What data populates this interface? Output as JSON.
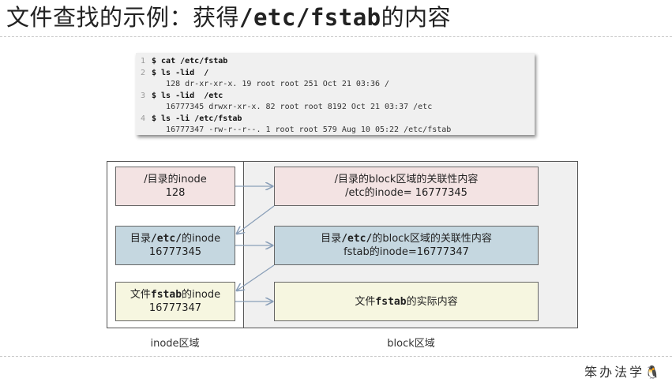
{
  "title": {
    "prefix": "文件查找的示例：获得",
    "path": "/etc/fstab",
    "suffix": "的内容"
  },
  "code_lines": [
    {
      "num": "1",
      "text": "$ cat /etc/fstab",
      "kind": "cmd"
    },
    {
      "num": "2",
      "text": "$ ls -lid  /",
      "kind": "cmd"
    },
    {
      "num": "",
      "text": "   128 dr-xr-xr-x. 19 root root 251 Oct 21 03:36 /",
      "kind": "out"
    },
    {
      "num": "3",
      "text": "$ ls -lid  /etc",
      "kind": "cmd"
    },
    {
      "num": "",
      "text": "   16777345 drwxr-xr-x. 82 root root 8192 Oct 21 03:37 /etc",
      "kind": "out"
    },
    {
      "num": "4",
      "text": "$ ls -li /etc/fstab",
      "kind": "cmd"
    },
    {
      "num": "",
      "text": "   16777347 -rw-r--r--. 1 root root 579 Aug 10 05:22 /etc/fstab",
      "kind": "out"
    }
  ],
  "inode_boxes": {
    "root": {
      "line1": "/目录的inode",
      "line2": "128"
    },
    "etc": {
      "pre": "目录",
      "mono": "/etc/",
      "post": "的inode",
      "line2": "16777345"
    },
    "fstab": {
      "pre": "文件",
      "mono": "fstab",
      "post": "的inode",
      "line2": "16777347"
    }
  },
  "block_boxes": {
    "root": {
      "line1": "/目录的block区域的关联性内容",
      "line2": "/etc的inode= 16777345"
    },
    "etc": {
      "pre": "目录",
      "mono": "/etc/",
      "post": "的block区域的关联性内容",
      "line2": "fstab的inode=16777347"
    },
    "fstab": {
      "pre": "文件",
      "mono": "fstab",
      "post": "的实际内容"
    }
  },
  "captions": {
    "inode": "inode区域",
    "block": "block区域"
  },
  "footer": "笨办法学🐧"
}
